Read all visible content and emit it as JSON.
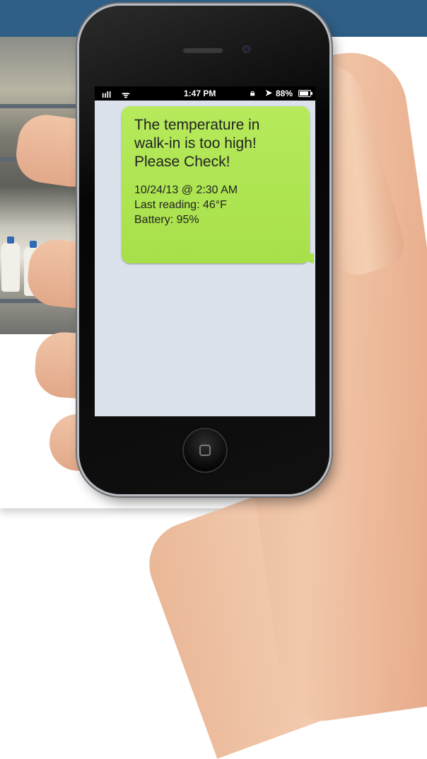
{
  "status_bar": {
    "signal": "ııll",
    "wifi": "ᯤ",
    "time": "1:47 PM",
    "lock_icon": "orientation-lock-icon",
    "location_icon": "location-arrow-icon",
    "battery_percent": "88%",
    "battery_level": 0.88
  },
  "message": {
    "headline": "The temperature in walk-in is too high! Please Check!",
    "timestamp": "10/24/13 @ 2:30 AM",
    "last_reading": "Last reading: 46°F",
    "battery": "Battery: 95%"
  },
  "colors": {
    "header_band": "#2f5f86",
    "bubble": "#a7e04a",
    "screen_background": "#dbe2ec"
  }
}
